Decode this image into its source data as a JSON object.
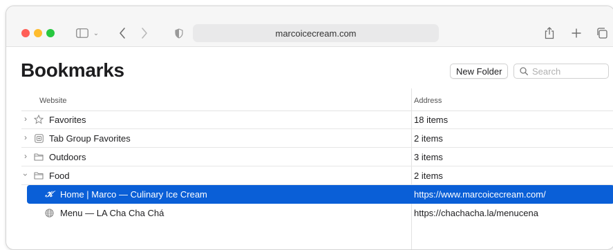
{
  "browser": {
    "address": "marcoicecream.com"
  },
  "page": {
    "title": "Bookmarks",
    "new_folder_label": "New Folder",
    "search_placeholder": "Search"
  },
  "table": {
    "columns": {
      "website": "Website",
      "address": "Address"
    },
    "rows": [
      {
        "title": "Favorites",
        "address": "18 items",
        "icon": "star-icon",
        "expanded": false
      },
      {
        "title": "Tab Group Favorites",
        "address": "2 items",
        "icon": "tab-group-icon",
        "expanded": false
      },
      {
        "title": "Outdoors",
        "address": "3 items",
        "icon": "folder-icon",
        "expanded": false
      },
      {
        "title": "Food",
        "address": "2 items",
        "icon": "folder-icon",
        "expanded": true
      },
      {
        "title": "Home | Marco — Culinary Ice Cream",
        "address": "https://www.marcoicecream.com/",
        "icon": "site-favicon-icon",
        "selected": true
      },
      {
        "title": "Menu — LA Cha Cha Chá",
        "address": "https://chachacha.la/menucena",
        "icon": "globe-icon"
      }
    ]
  },
  "colors": {
    "selection": "#0a5fd7",
    "traffic_red": "#ff5f57",
    "traffic_yellow": "#febc2e",
    "traffic_green": "#28c840"
  }
}
